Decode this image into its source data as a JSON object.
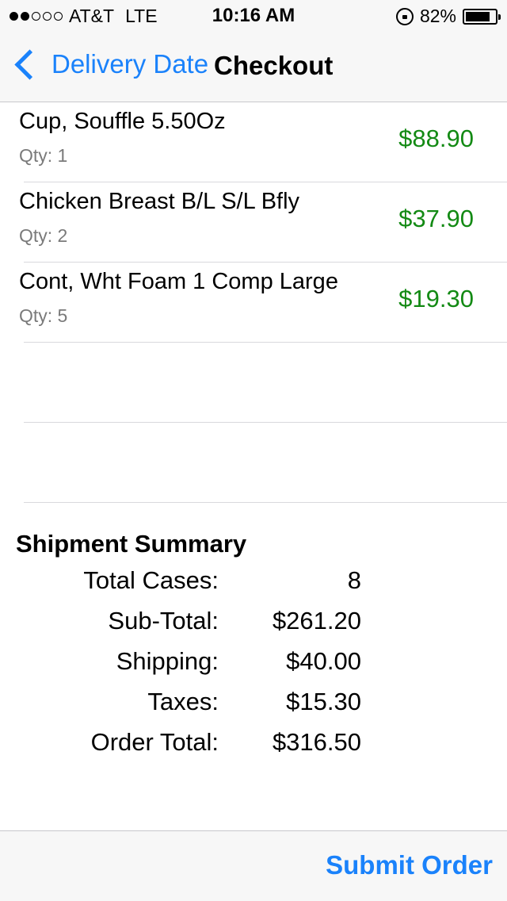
{
  "status_bar": {
    "signal_filled": 2,
    "signal_total": 5,
    "carrier": "AT&T",
    "network": "LTE",
    "time": "10:16 AM",
    "battery": "82%",
    "icons": [
      "rotation-lock-icon",
      "battery-icon"
    ]
  },
  "nav": {
    "back_label": "Delivery Date",
    "title": "Checkout",
    "accent_color": "#1a82fb"
  },
  "items": [
    {
      "name": "Cup, Souffle 5.50Oz",
      "qty": "Qty: 1",
      "price": "$88.90"
    },
    {
      "name": "Chicken Breast B/L S/L Bfly",
      "qty": "Qty: 2",
      "price": "$37.90"
    },
    {
      "name": "Cont, Wht Foam 1 Comp Large",
      "qty": "Qty: 5",
      "price": "$19.30"
    }
  ],
  "price_color": "#138a14",
  "summary": {
    "title": "Shipment Summary",
    "rows": [
      {
        "label": "Total Cases:",
        "value": "8"
      },
      {
        "label": "Sub-Total:",
        "value": "$261.20"
      },
      {
        "label": "Shipping:",
        "value": "$40.00"
      },
      {
        "label": "Taxes:",
        "value": "$15.30"
      },
      {
        "label": "Order Total:",
        "value": "$316.50"
      }
    ]
  },
  "toolbar": {
    "submit_label": "Submit Order"
  }
}
